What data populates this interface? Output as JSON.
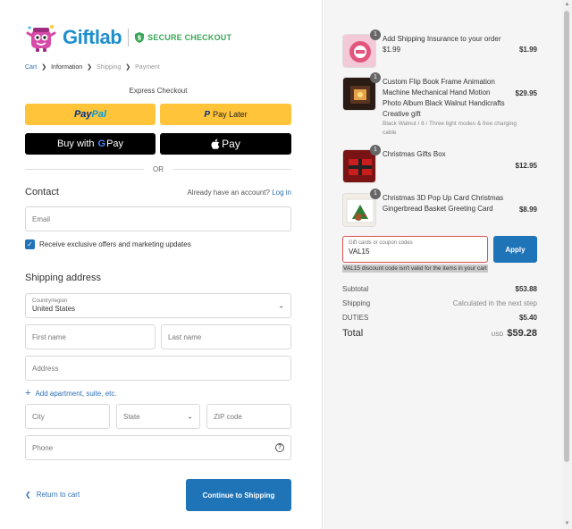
{
  "brand": {
    "name": "Giftlab",
    "secure_label": "SECURE CHECKOUT",
    "brand_color": "#1f8fcc",
    "secure_color": "#3aa657"
  },
  "breadcrumb": {
    "items": [
      "Cart",
      "Information",
      "Shipping",
      "Payment"
    ]
  },
  "express": {
    "title": "Express Checkout",
    "paypal_label_a": "Pay",
    "paypal_label_b": "Pal",
    "paylater_label": "Pay Later",
    "gpay_label": "Buy with",
    "gpay_suffix": "Pay",
    "applepay_label": "Pay",
    "or_label": "OR"
  },
  "contact": {
    "title": "Contact",
    "account_prompt": "Already have an account?",
    "login_label": "Log in",
    "email_placeholder": "Email",
    "marketing_label": "Receive exclusive offers and marketing updates",
    "marketing_checked": true
  },
  "shipping": {
    "title": "Shipping address",
    "country_label": "Country/region",
    "country_value": "United States",
    "first_name_placeholder": "First name",
    "last_name_placeholder": "Last name",
    "address_placeholder": "Address",
    "add_apartment_label": "Add apartment, suite, etc.",
    "city_placeholder": "City",
    "state_placeholder": "State",
    "zip_placeholder": "ZIP code",
    "phone_placeholder": "Phone",
    "help_label": "?"
  },
  "actions": {
    "return_label": "Return to cart",
    "continue_label": "Continue to Shipping",
    "accent": "#1f73b7"
  },
  "order": {
    "items": [
      {
        "qty": "1",
        "name": "Add Shipping Insurance to your order",
        "sub_price": "$1.99",
        "variant": "",
        "price": "$1.99"
      },
      {
        "qty": "1",
        "name": "Custom Flip Book Frame Animation Machine Mechanical Hand Motion Photo Album Black Walnut Handicrafts Creative gift",
        "sub_price": "",
        "variant": "Black Walnut / 8 / Three light modes & free charging cable",
        "price": "$29.95"
      },
      {
        "qty": "1",
        "name": "Christmas Gifts Box",
        "sub_price": "",
        "variant": "",
        "price": "$12.95"
      },
      {
        "qty": "1",
        "name": "Christmas 3D Pop Up Card Christmas Gingerbread Basket Greeting Card",
        "sub_price": "",
        "variant": "",
        "price": "$8.99"
      }
    ],
    "coupon_label": "Gift cards or coupon codes",
    "coupon_value": "VAL15",
    "apply_label": "Apply",
    "coupon_error": "VAL15 discount code isn't valid for the items in your cart",
    "error_color": "#d9534f"
  },
  "summary": {
    "subtotal_label": "Subtotal",
    "subtotal_value": "$53.88",
    "shipping_label": "Shipping",
    "shipping_value": "Calculated in the next step",
    "duties_label": "DUTIES",
    "duties_value": "$5.40",
    "total_label": "Total",
    "total_currency": "USD",
    "total_value": "$59.28"
  }
}
